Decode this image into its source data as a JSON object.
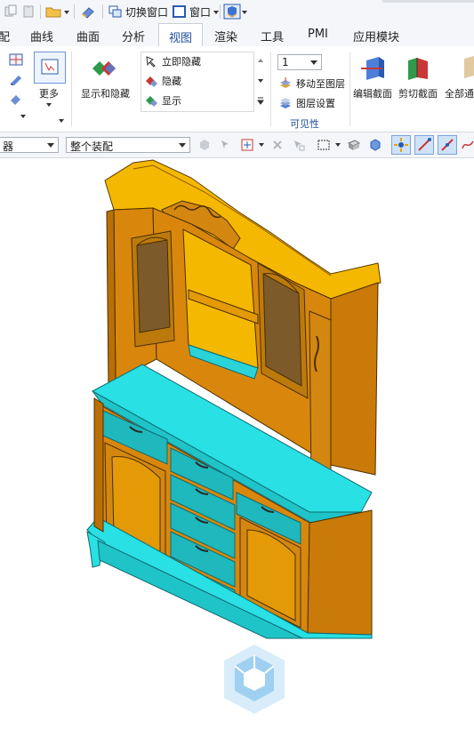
{
  "qat": {
    "switch_window_label": "切换窗口",
    "window_label": "窗口"
  },
  "tabs": [
    {
      "label": "配"
    },
    {
      "label": "曲线"
    },
    {
      "label": "曲面"
    },
    {
      "label": "分析"
    },
    {
      "label": "视图",
      "active": true
    },
    {
      "label": "渲染"
    },
    {
      "label": "工具"
    },
    {
      "label": "PMI"
    },
    {
      "label": "应用模块"
    }
  ],
  "ribbon": {
    "more_label": "更多",
    "show_hide_label": "显示和隐藏",
    "immediate_hide_label": "立即隐藏",
    "hide_label": "隐藏",
    "show_label": "显示",
    "layer_value": "1",
    "move_to_layer_label": "移动至图层",
    "layer_settings_label": "图层设置",
    "visibility_group_label": "可见性",
    "edit_section_label": "编辑截面",
    "clip_section_label": "剪切截面",
    "all_label": "全部通"
  },
  "toolbar": {
    "left_combo_value": "器",
    "assembly_combo_value": "整个装配"
  },
  "colors": {
    "accent": "#1f4e9b",
    "cabinet_orange": "#d9870c",
    "cabinet_gold": "#f5b800",
    "highlight_cyan": "#29e0e4"
  }
}
